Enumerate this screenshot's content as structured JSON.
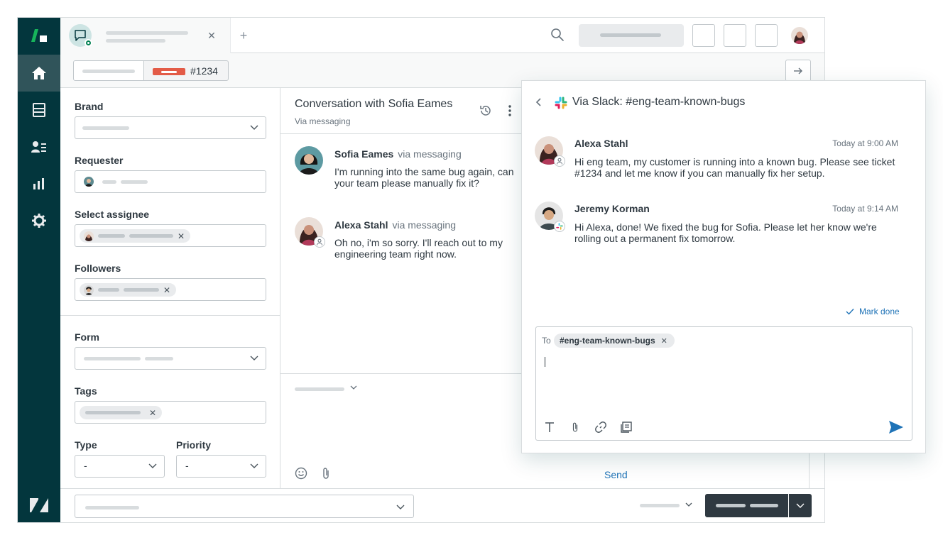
{
  "header": {
    "ticket_number": "#1234"
  },
  "fields": {
    "brand_label": "Brand",
    "requester_label": "Requester",
    "assignee_label": "Select assignee",
    "followers_label": "Followers",
    "form_label": "Form",
    "tags_label": "Tags",
    "type_label": "Type",
    "type_value": "-",
    "priority_label": "Priority",
    "priority_value": "-"
  },
  "conversation": {
    "title": "Conversation with Sofia Eames",
    "subtitle": "Via messaging",
    "messages": [
      {
        "author": "Sofia Eames",
        "channel": "via messaging",
        "text": "I'm running into the same bug again, can your team please manually fix it?"
      },
      {
        "author": "Alexa Stahl",
        "channel": "via messaging",
        "text": "Oh no, i'm so sorry. I'll reach out to my engineering team right now."
      }
    ],
    "send_label": "Send"
  },
  "slack": {
    "title": "Via Slack: #eng-team-known-bugs",
    "messages": [
      {
        "author": "Alexa Stahl",
        "time": "Today at 9:00 AM",
        "text": "Hi eng team, my customer is running into a known bug. Please see ticket #1234 and let me know if you can manually fix her setup."
      },
      {
        "author": "Jeremy Korman",
        "time": "Today at 9:14 AM",
        "text": "Hi Alexa, done! We fixed the bug for Sofia. Please let her know we're rolling out a permanent fix tomorrow."
      }
    ],
    "mark_done_label": "Mark done",
    "to_label": "To",
    "to_channel": "#eng-team-known-bugs"
  },
  "colors": {
    "rail": "#03363d",
    "rail_active": "#30545a",
    "accent_blue": "#1f73b7",
    "status_open": "#e35b47",
    "online_green": "#038153"
  }
}
